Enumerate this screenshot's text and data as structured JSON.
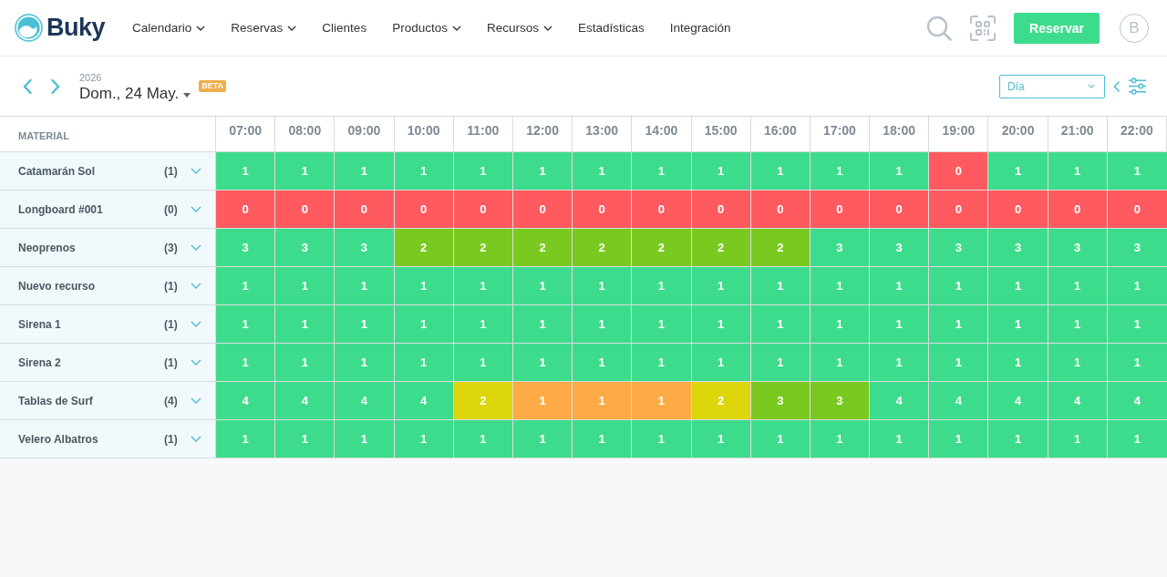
{
  "header": {
    "logo_text": "Buky",
    "nav": [
      {
        "label": "Calendario",
        "kind": "menu"
      },
      {
        "label": "Reservas",
        "kind": "menu"
      },
      {
        "label": "Clientes",
        "kind": "link"
      },
      {
        "label": "Productos",
        "kind": "menu"
      },
      {
        "label": "Recursos",
        "kind": "menu"
      },
      {
        "label": "Estadísticas",
        "kind": "link"
      },
      {
        "label": "Integración",
        "kind": "link"
      }
    ],
    "action_button": "Reservar",
    "avatar_initial": "B"
  },
  "toolbar": {
    "year": "2026",
    "date": "Dom., 24 May.",
    "badge": "BETA",
    "view_select": "Día"
  },
  "table": {
    "first_column": "MATERIAL",
    "hours": [
      "07:00",
      "08:00",
      "09:00",
      "10:00",
      "11:00",
      "12:00",
      "13:00",
      "14:00",
      "15:00",
      "16:00",
      "17:00",
      "18:00",
      "19:00",
      "20:00",
      "21:00",
      "22:00"
    ],
    "rows": [
      {
        "name": "Catamarán Sol",
        "count": "(1)",
        "expanded": false,
        "cells": [
          {
            "value": "1",
            "color": "#3ddc8c"
          },
          {
            "value": "1",
            "color": "#3ddc8c"
          },
          {
            "value": "1",
            "color": "#3ddc8c"
          },
          {
            "value": "1",
            "color": "#3ddc8c"
          },
          {
            "value": "1",
            "color": "#3ddc8c"
          },
          {
            "value": "1",
            "color": "#3ddc8c"
          },
          {
            "value": "1",
            "color": "#3ddc8c"
          },
          {
            "value": "1",
            "color": "#3ddc8c"
          },
          {
            "value": "1",
            "color": "#3ddc8c"
          },
          {
            "value": "1",
            "color": "#3ddc8c"
          },
          {
            "value": "1",
            "color": "#3ddc8c"
          },
          {
            "value": "1",
            "color": "#3ddc8c"
          },
          {
            "value": "0",
            "color": "#ff5a5f"
          },
          {
            "value": "1",
            "color": "#3ddc8c"
          },
          {
            "value": "1",
            "color": "#3ddc8c"
          },
          {
            "value": "1",
            "color": "#3ddc8c"
          }
        ]
      },
      {
        "name": "Longboard #001",
        "count": "(0)",
        "expanded": false,
        "cells": [
          {
            "value": "0",
            "color": "#ff5a5f"
          },
          {
            "value": "0",
            "color": "#ff5a5f"
          },
          {
            "value": "0",
            "color": "#ff5a5f"
          },
          {
            "value": "0",
            "color": "#ff5a5f"
          },
          {
            "value": "0",
            "color": "#ff5a5f"
          },
          {
            "value": "0",
            "color": "#ff5a5f"
          },
          {
            "value": "0",
            "color": "#ff5a5f"
          },
          {
            "value": "0",
            "color": "#ff5a5f"
          },
          {
            "value": "0",
            "color": "#ff5a5f"
          },
          {
            "value": "0",
            "color": "#ff5a5f"
          },
          {
            "value": "0",
            "color": "#ff5a5f"
          },
          {
            "value": "0",
            "color": "#ff5a5f"
          },
          {
            "value": "0",
            "color": "#ff5a5f"
          },
          {
            "value": "0",
            "color": "#ff5a5f"
          },
          {
            "value": "0",
            "color": "#ff5a5f"
          },
          {
            "value": "0",
            "color": "#ff5a5f"
          }
        ]
      },
      {
        "name": "Neoprenos",
        "count": "(3)",
        "expanded": false,
        "cells": [
          {
            "value": "3",
            "color": "#3ddc8c"
          },
          {
            "value": "3",
            "color": "#3ddc8c"
          },
          {
            "value": "3",
            "color": "#3ddc8c"
          },
          {
            "value": "2",
            "color": "#7ac920"
          },
          {
            "value": "2",
            "color": "#7ac920"
          },
          {
            "value": "2",
            "color": "#7ac920"
          },
          {
            "value": "2",
            "color": "#7ac920"
          },
          {
            "value": "2",
            "color": "#7ac920"
          },
          {
            "value": "2",
            "color": "#7ac920"
          },
          {
            "value": "2",
            "color": "#7ac920"
          },
          {
            "value": "3",
            "color": "#3ddc8c"
          },
          {
            "value": "3",
            "color": "#3ddc8c"
          },
          {
            "value": "3",
            "color": "#3ddc8c"
          },
          {
            "value": "3",
            "color": "#3ddc8c"
          },
          {
            "value": "3",
            "color": "#3ddc8c"
          },
          {
            "value": "3",
            "color": "#3ddc8c"
          }
        ]
      },
      {
        "name": "Nuevo recurso",
        "count": "(1)",
        "expanded": false,
        "cells": [
          {
            "value": "1",
            "color": "#3ddc8c"
          },
          {
            "value": "1",
            "color": "#3ddc8c"
          },
          {
            "value": "1",
            "color": "#3ddc8c"
          },
          {
            "value": "1",
            "color": "#3ddc8c"
          },
          {
            "value": "1",
            "color": "#3ddc8c"
          },
          {
            "value": "1",
            "color": "#3ddc8c"
          },
          {
            "value": "1",
            "color": "#3ddc8c"
          },
          {
            "value": "1",
            "color": "#3ddc8c"
          },
          {
            "value": "1",
            "color": "#3ddc8c"
          },
          {
            "value": "1",
            "color": "#3ddc8c"
          },
          {
            "value": "1",
            "color": "#3ddc8c"
          },
          {
            "value": "1",
            "color": "#3ddc8c"
          },
          {
            "value": "1",
            "color": "#3ddc8c"
          },
          {
            "value": "1",
            "color": "#3ddc8c"
          },
          {
            "value": "1",
            "color": "#3ddc8c"
          },
          {
            "value": "1",
            "color": "#3ddc8c"
          }
        ]
      },
      {
        "name": "Sirena 1",
        "count": "(1)",
        "expanded": false,
        "cells": [
          {
            "value": "1",
            "color": "#3ddc8c"
          },
          {
            "value": "1",
            "color": "#3ddc8c"
          },
          {
            "value": "1",
            "color": "#3ddc8c"
          },
          {
            "value": "1",
            "color": "#3ddc8c"
          },
          {
            "value": "1",
            "color": "#3ddc8c"
          },
          {
            "value": "1",
            "color": "#3ddc8c"
          },
          {
            "value": "1",
            "color": "#3ddc8c"
          },
          {
            "value": "1",
            "color": "#3ddc8c"
          },
          {
            "value": "1",
            "color": "#3ddc8c"
          },
          {
            "value": "1",
            "color": "#3ddc8c"
          },
          {
            "value": "1",
            "color": "#3ddc8c"
          },
          {
            "value": "1",
            "color": "#3ddc8c"
          },
          {
            "value": "1",
            "color": "#3ddc8c"
          },
          {
            "value": "1",
            "color": "#3ddc8c"
          },
          {
            "value": "1",
            "color": "#3ddc8c"
          },
          {
            "value": "1",
            "color": "#3ddc8c"
          }
        ]
      },
      {
        "name": "Sirena 2",
        "count": "(1)",
        "expanded": false,
        "cells": [
          {
            "value": "1",
            "color": "#3ddc8c"
          },
          {
            "value": "1",
            "color": "#3ddc8c"
          },
          {
            "value": "1",
            "color": "#3ddc8c"
          },
          {
            "value": "1",
            "color": "#3ddc8c"
          },
          {
            "value": "1",
            "color": "#3ddc8c"
          },
          {
            "value": "1",
            "color": "#3ddc8c"
          },
          {
            "value": "1",
            "color": "#3ddc8c"
          },
          {
            "value": "1",
            "color": "#3ddc8c"
          },
          {
            "value": "1",
            "color": "#3ddc8c"
          },
          {
            "value": "1",
            "color": "#3ddc8c"
          },
          {
            "value": "1",
            "color": "#3ddc8c"
          },
          {
            "value": "1",
            "color": "#3ddc8c"
          },
          {
            "value": "1",
            "color": "#3ddc8c"
          },
          {
            "value": "1",
            "color": "#3ddc8c"
          },
          {
            "value": "1",
            "color": "#3ddc8c"
          },
          {
            "value": "1",
            "color": "#3ddc8c"
          }
        ]
      },
      {
        "name": "Tablas de Surf",
        "count": "(4)",
        "expanded": false,
        "cells": [
          {
            "value": "4",
            "color": "#3ddc8c"
          },
          {
            "value": "4",
            "color": "#3ddc8c"
          },
          {
            "value": "4",
            "color": "#3ddc8c"
          },
          {
            "value": "4",
            "color": "#3ddc8c"
          },
          {
            "value": "2",
            "color": "#dcd60a"
          },
          {
            "value": "1",
            "color": "#ffab45"
          },
          {
            "value": "1",
            "color": "#ffab45"
          },
          {
            "value": "1",
            "color": "#ffab45"
          },
          {
            "value": "2",
            "color": "#dcd60a"
          },
          {
            "value": "3",
            "color": "#7ac920"
          },
          {
            "value": "3",
            "color": "#7ac920"
          },
          {
            "value": "4",
            "color": "#3ddc8c"
          },
          {
            "value": "4",
            "color": "#3ddc8c"
          },
          {
            "value": "4",
            "color": "#3ddc8c"
          },
          {
            "value": "4",
            "color": "#3ddc8c"
          },
          {
            "value": "4",
            "color": "#3ddc8c"
          }
        ]
      },
      {
        "name": "Velero Albatros",
        "count": "(1)",
        "expanded": false,
        "cells": [
          {
            "value": "1",
            "color": "#3ddc8c"
          },
          {
            "value": "1",
            "color": "#3ddc8c"
          },
          {
            "value": "1",
            "color": "#3ddc8c"
          },
          {
            "value": "1",
            "color": "#3ddc8c"
          },
          {
            "value": "1",
            "color": "#3ddc8c"
          },
          {
            "value": "1",
            "color": "#3ddc8c"
          },
          {
            "value": "1",
            "color": "#3ddc8c"
          },
          {
            "value": "1",
            "color": "#3ddc8c"
          },
          {
            "value": "1",
            "color": "#3ddc8c"
          },
          {
            "value": "1",
            "color": "#3ddc8c"
          },
          {
            "value": "1",
            "color": "#3ddc8c"
          },
          {
            "value": "1",
            "color": "#3ddc8c"
          },
          {
            "value": "1",
            "color": "#3ddc8c"
          },
          {
            "value": "1",
            "color": "#3ddc8c"
          },
          {
            "value": "1",
            "color": "#3ddc8c"
          },
          {
            "value": "1",
            "color": "#3ddc8c"
          }
        ]
      }
    ]
  }
}
